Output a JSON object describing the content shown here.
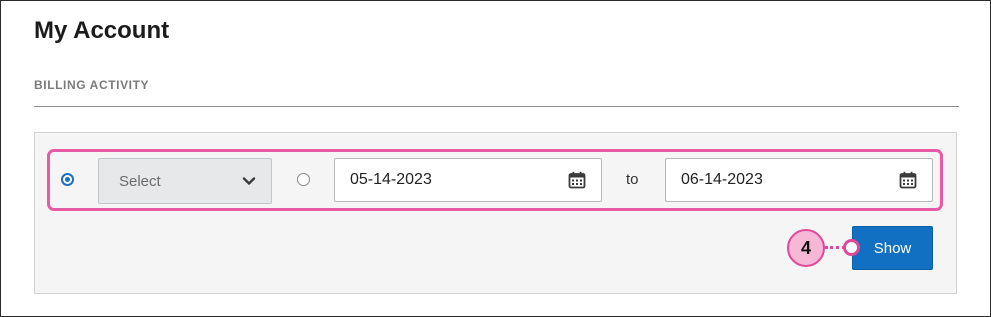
{
  "page": {
    "title": "My Account",
    "section_label": "BILLING ACTIVITY"
  },
  "filter": {
    "period_radio_selected": true,
    "range_radio_selected": false,
    "period_select": {
      "value": "Select"
    },
    "start_date": "05-14-2023",
    "to_label": "to",
    "end_date": "06-14-2023",
    "show_button_label": "Show"
  },
  "callout": {
    "number": "4"
  },
  "colors": {
    "accent_blue": "#1170c1",
    "highlight_pink": "#e85aa3",
    "callout_fill": "#f7b8d6"
  },
  "icons": {
    "date_picker": "calendar-icon",
    "dropdown": "chevron-down-icon"
  }
}
